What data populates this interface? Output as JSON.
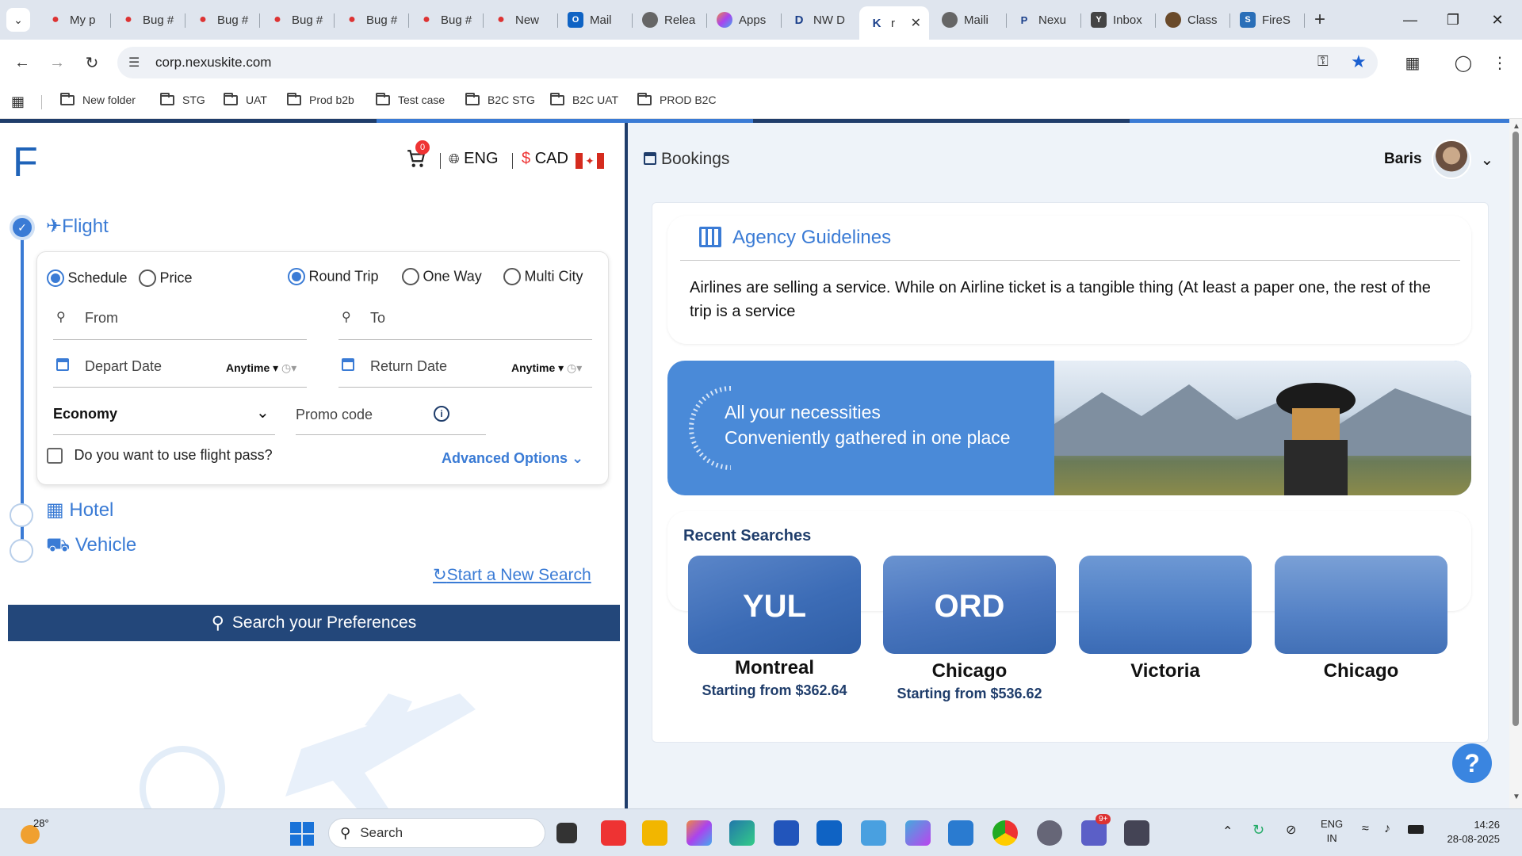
{
  "browser": {
    "tabs": [
      {
        "title": "My p",
        "icon": "jira-icon"
      },
      {
        "title": "Bug #",
        "icon": "jira-icon"
      },
      {
        "title": "Bug #",
        "icon": "jira-icon"
      },
      {
        "title": "Bug #",
        "icon": "jira-icon"
      },
      {
        "title": "Bug #",
        "icon": "jira-icon"
      },
      {
        "title": "Bug #",
        "icon": "jira-icon"
      },
      {
        "title": "New",
        "icon": "jira-icon"
      },
      {
        "title": "Mail",
        "icon": "outlook-icon"
      },
      {
        "title": "Relea",
        "icon": "globe-icon"
      },
      {
        "title": "Apps",
        "icon": "apps-icon"
      },
      {
        "title": "NW D",
        "icon": "d-icon"
      },
      {
        "title": "r",
        "icon": "k-icon"
      },
      {
        "title": "Maili",
        "icon": "globe-icon"
      },
      {
        "title": "Nexu",
        "icon": "p-icon"
      },
      {
        "title": "Inbox",
        "icon": "yahoo-icon"
      },
      {
        "title": "Class",
        "icon": "class-icon"
      },
      {
        "title": "FireS",
        "icon": "s-icon"
      }
    ],
    "url": "corp.nexuskite.com",
    "bookmarks": [
      "New folder",
      "STG",
      "UAT",
      "Prod b2b",
      "Test case",
      "B2C STG",
      "B2C UAT",
      "PROD B2C"
    ]
  },
  "left": {
    "logo": "F",
    "cart_count": "0",
    "language": "ENG",
    "currency_symbol": "$",
    "currency": "CAD",
    "flight_title": "Flight",
    "schedule": "Schedule",
    "price": "Price",
    "round_trip": "Round Trip",
    "one_way": "One Way",
    "multi_city": "Multi City",
    "from": "From",
    "to": "To",
    "depart": "Depart Date",
    "return": "Return Date",
    "anytime": "Anytime",
    "cabin": "Economy",
    "promo": "Promo code",
    "flight_pass": "Do you want to use flight pass?",
    "advanced": "Advanced Options",
    "hotel": "Hotel",
    "vehicle": "Vehicle",
    "new_search": "Start a New Search",
    "search_button": "Search your Preferences"
  },
  "right": {
    "bookings": "Bookings",
    "user": "Baris",
    "guidelines_title": "Agency Guidelines",
    "guidelines_text": "Airlines are selling a service. While on Airline ticket is a tangible thing (At least a paper one, the rest of the trip is a service",
    "banner_line1": "All your necessities",
    "banner_line2": "Conveniently gathered in one place",
    "recent_title": "Recent Searches",
    "recent": [
      {
        "code": "YUL",
        "city": "Montreal",
        "price": "Starting from $362.64"
      },
      {
        "code": "ORD",
        "city": "Chicago",
        "price": "Starting from $536.62"
      },
      {
        "code": "",
        "city": "Victoria",
        "price": ""
      },
      {
        "code": "",
        "city": "Chicago",
        "price": ""
      }
    ],
    "help": "?"
  },
  "taskbar": {
    "weather": "28°",
    "search": "Search",
    "teams_badge": "9+",
    "lang1": "ENG",
    "lang2": "IN",
    "time": "14:26",
    "date": "28-08-2025"
  },
  "colors": {
    "brand": "#1f3d6b",
    "accent": "#3a7bd5",
    "link": "#3a7bd5"
  }
}
